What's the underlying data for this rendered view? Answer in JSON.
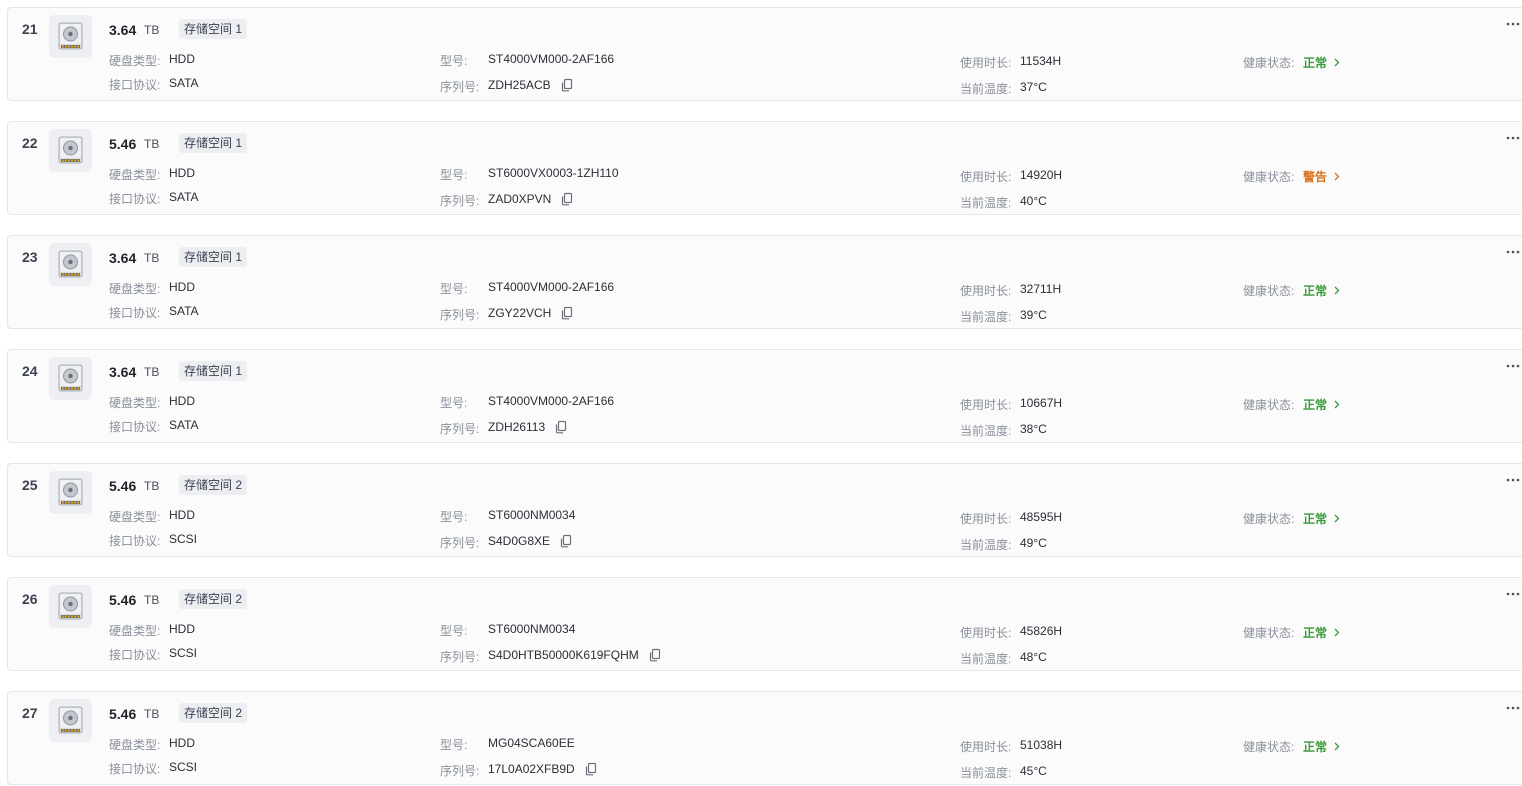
{
  "labels": {
    "capacity_unit": "TB",
    "disk_type": "硬盘类型:",
    "protocol": "接口协议:",
    "model": "型号:",
    "serial": "序列号:",
    "hours": "使用时长:",
    "temp": "当前温度:",
    "health": "健康状态:"
  },
  "colors": {
    "health_normal": "#3a9c3a",
    "health_warning": "#d9731a"
  },
  "icons": {
    "disk": "hard-disk-icon",
    "copy": "copy-icon",
    "chevron": "chevron-right-icon",
    "more": "more-horizontal-icon"
  },
  "disks": [
    {
      "index": "21",
      "capacity": "3.64",
      "pool": "存储空间 1",
      "type": "HDD",
      "protocol": "SATA",
      "model": "ST4000VM000-2AF166",
      "serial": "ZDH25ACB",
      "hours": "11534H",
      "temp": "37°C",
      "health": "正常",
      "health_level": "normal"
    },
    {
      "index": "22",
      "capacity": "5.46",
      "pool": "存储空间 1",
      "type": "HDD",
      "protocol": "SATA",
      "model": "ST6000VX0003-1ZH110",
      "serial": "ZAD0XPVN",
      "hours": "14920H",
      "temp": "40°C",
      "health": "警告",
      "health_level": "warning"
    },
    {
      "index": "23",
      "capacity": "3.64",
      "pool": "存储空间 1",
      "type": "HDD",
      "protocol": "SATA",
      "model": "ST4000VM000-2AF166",
      "serial": "ZGY22VCH",
      "hours": "32711H",
      "temp": "39°C",
      "health": "正常",
      "health_level": "normal"
    },
    {
      "index": "24",
      "capacity": "3.64",
      "pool": "存储空间 1",
      "type": "HDD",
      "protocol": "SATA",
      "model": "ST4000VM000-2AF166",
      "serial": "ZDH26113",
      "hours": "10667H",
      "temp": "38°C",
      "health": "正常",
      "health_level": "normal"
    },
    {
      "index": "25",
      "capacity": "5.46",
      "pool": "存储空间 2",
      "type": "HDD",
      "protocol": "SCSI",
      "model": "ST6000NM0034",
      "serial": "S4D0G8XE",
      "hours": "48595H",
      "temp": "49°C",
      "health": "正常",
      "health_level": "normal"
    },
    {
      "index": "26",
      "capacity": "5.46",
      "pool": "存储空间 2",
      "type": "HDD",
      "protocol": "SCSI",
      "model": "ST6000NM0034",
      "serial": "S4D0HTB50000K619FQHM",
      "hours": "45826H",
      "temp": "48°C",
      "health": "正常",
      "health_level": "normal"
    },
    {
      "index": "27",
      "capacity": "5.46",
      "pool": "存储空间 2",
      "type": "HDD",
      "protocol": "SCSI",
      "model": "MG04SCA60EE",
      "serial": "17L0A02XFB9D",
      "hours": "51038H",
      "temp": "45°C",
      "health": "正常",
      "health_level": "normal"
    }
  ]
}
